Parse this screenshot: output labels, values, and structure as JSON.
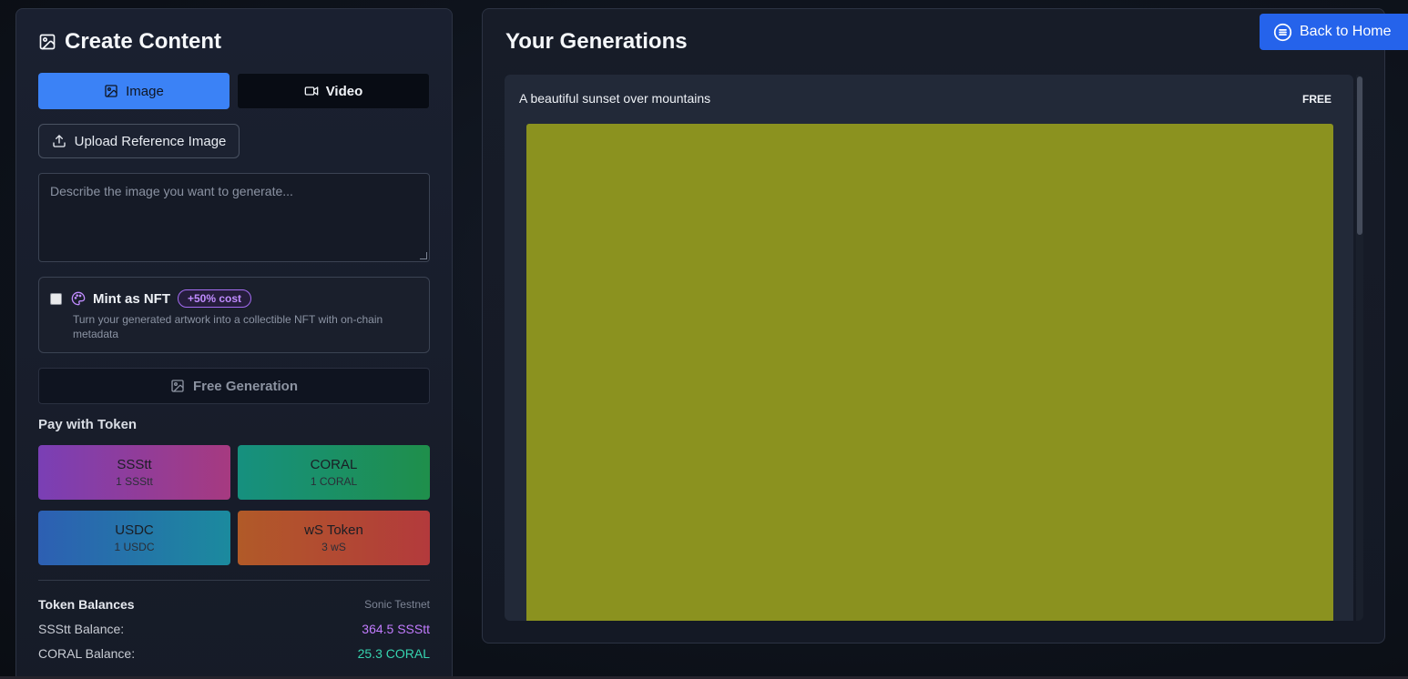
{
  "create": {
    "title": "Create Content",
    "mode_image": "Image",
    "mode_video": "Video",
    "upload_label": "Upload Reference Image",
    "prompt_placeholder": "Describe the image you want to generate...",
    "nft_label": "Mint as NFT",
    "nft_badge": "+50% cost",
    "nft_desc": "Turn your generated artwork into a collectible NFT with on-chain metadata",
    "free_label": "Free Generation",
    "pay_title": "Pay with Token",
    "tokens": [
      {
        "name": "SSStt",
        "price": "1 SSStt"
      },
      {
        "name": "CORAL",
        "price": "1 CORAL"
      },
      {
        "name": "USDC",
        "price": "1 USDC"
      },
      {
        "name": "wS Token",
        "price": "3 wS"
      }
    ],
    "balances_title": "Token Balances",
    "network": "Sonic Testnet",
    "balances": [
      {
        "label": "SSStt Balance:",
        "value": "364.5 SSStt"
      },
      {
        "label": "CORAL Balance:",
        "value": "25.3 CORAL"
      }
    ]
  },
  "generations": {
    "title": "Your Generations",
    "items": [
      {
        "prompt": "A beautiful sunset over mountains",
        "badge": "FREE",
        "image_color": "#8b921f"
      }
    ]
  },
  "nav": {
    "home_label": "Back to Home"
  },
  "colors": {
    "accent": "#3b82f6",
    "home_button": "#2563eb",
    "nft_badge": "#c08cff",
    "ssstt_balance": "#c27cff",
    "coral_balance": "#36d4b0"
  },
  "icons": [
    "image-icon",
    "video-icon",
    "upload-icon",
    "palette-icon",
    "menu-circle-icon"
  ]
}
